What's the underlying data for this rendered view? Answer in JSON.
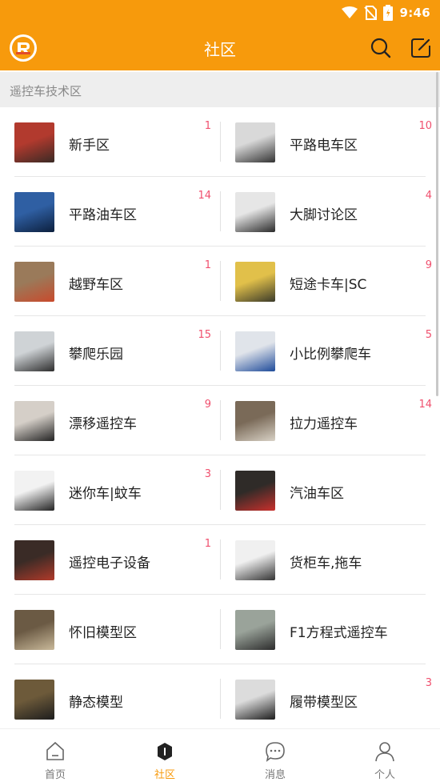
{
  "status_bar": {
    "time": "9:46"
  },
  "app_bar": {
    "title": "社区"
  },
  "section": {
    "title": "遥控车技术区"
  },
  "colors": {
    "brand": "#f79a0c",
    "badge": "#f0506e"
  },
  "forums": [
    {
      "left": {
        "label": "新手区",
        "count": "1"
      },
      "right": {
        "label": "平路电车区",
        "count": "10"
      }
    },
    {
      "left": {
        "label": "平路油车区",
        "count": "14"
      },
      "right": {
        "label": "大脚讨论区",
        "count": "4"
      }
    },
    {
      "left": {
        "label": "越野车区",
        "count": "1"
      },
      "right": {
        "label": "短途卡车|SC",
        "count": "9"
      }
    },
    {
      "left": {
        "label": "攀爬乐园",
        "count": "15"
      },
      "right": {
        "label": "小比例攀爬车",
        "count": "5"
      }
    },
    {
      "left": {
        "label": "漂移遥控车",
        "count": "9"
      },
      "right": {
        "label": "拉力遥控车",
        "count": "14"
      }
    },
    {
      "left": {
        "label": "迷你车|蚊车",
        "count": "3"
      },
      "right": {
        "label": "汽油车区",
        "count": ""
      }
    },
    {
      "left": {
        "label": "遥控电子设备",
        "count": "1"
      },
      "right": {
        "label": "货柜车,拖车",
        "count": ""
      }
    },
    {
      "left": {
        "label": "怀旧模型区",
        "count": ""
      },
      "right": {
        "label": "F1方程式遥控车",
        "count": ""
      }
    },
    {
      "left": {
        "label": "静态模型",
        "count": ""
      },
      "right": {
        "label": "履带模型区",
        "count": "3"
      }
    }
  ],
  "tabs": [
    {
      "label": "首页",
      "icon": "home-icon"
    },
    {
      "label": "社区",
      "icon": "community-icon",
      "active": true
    },
    {
      "label": "消息",
      "icon": "message-icon"
    },
    {
      "label": "个人",
      "icon": "profile-icon"
    }
  ]
}
